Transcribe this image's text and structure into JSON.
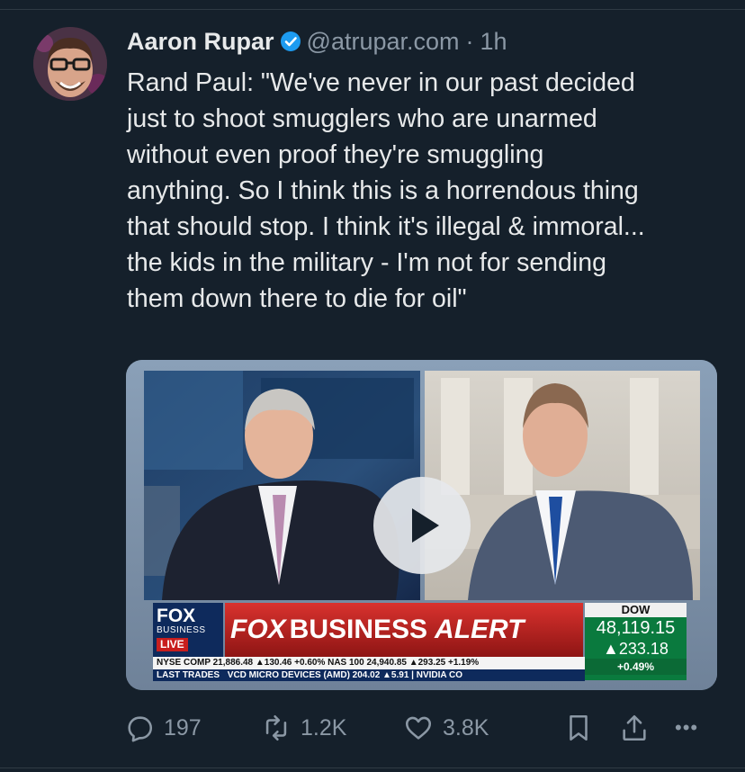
{
  "author": {
    "name": "Aaron Rupar",
    "handle": "@atrupar.com",
    "separator": "·",
    "time": "1h"
  },
  "tweet": {
    "text": "Rand Paul: \"We've never in our past decided\njust to shoot smugglers who are unarmed\nwithout even proof they're smuggling\nanything. So I think this is a horrendous thing\nthat should stop. I think it's illegal & immoral...\nthe kids in the military - I'm not for sending\nthem down there to die for oil\""
  },
  "video": {
    "logo_top": "FOX",
    "logo_sub": "BUSINESS",
    "live": "LIVE",
    "banner_brand": "FOX",
    "banner_word": "BUSINESS",
    "banner_alert": "ALERT",
    "dow_label": "DOW",
    "dow_value": "48,119.15",
    "dow_change": "233.18",
    "dow_pct": "+0.49",
    "dow_pct_unit": "%",
    "ticker_line1": "NYSE COMP 21,886.48 ▲130.46 +0.60% NAS 100 24,940.85 ▲293.25 +1.19%",
    "ticker_label2": "LAST TRADES",
    "ticker_line2": "VCD MICRO DEVICES (AMD) 204.02 ▲5.91 | NVIDIA CO"
  },
  "actions": {
    "replies": "197",
    "reposts": "1.2K",
    "likes": "3.8K",
    "more": "•••"
  },
  "colors": {
    "background": "#15202b",
    "text": "#e7e9ea",
    "muted": "#8b98a5",
    "verified": "#1d9bf0"
  },
  "icons": [
    "verified-badge-icon",
    "play-icon",
    "reply-icon",
    "repost-icon",
    "like-icon",
    "bookmark-icon",
    "share-icon",
    "more-icon"
  ]
}
